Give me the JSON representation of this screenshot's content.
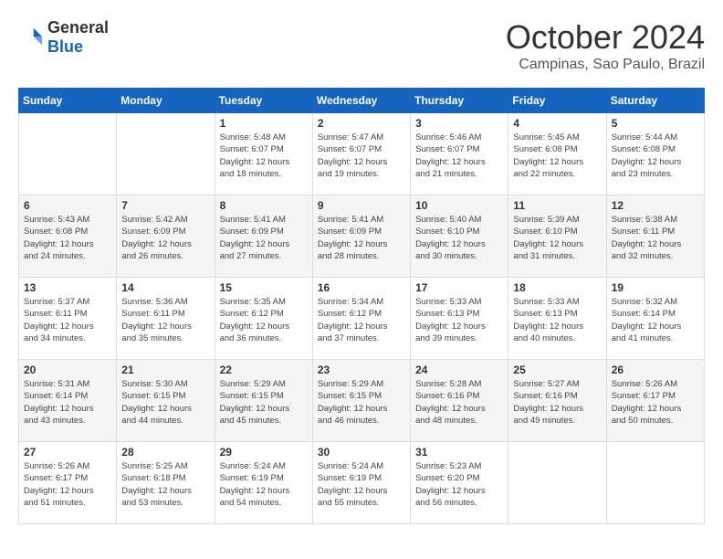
{
  "logo": {
    "general": "General",
    "blue": "Blue"
  },
  "title": {
    "month": "October 2024",
    "location": "Campinas, Sao Paulo, Brazil"
  },
  "headers": [
    "Sunday",
    "Monday",
    "Tuesday",
    "Wednesday",
    "Thursday",
    "Friday",
    "Saturday"
  ],
  "weeks": [
    [
      {
        "day": "",
        "info": ""
      },
      {
        "day": "",
        "info": ""
      },
      {
        "day": "1",
        "info": "Sunrise: 5:48 AM\nSunset: 6:07 PM\nDaylight: 12 hours\nand 18 minutes."
      },
      {
        "day": "2",
        "info": "Sunrise: 5:47 AM\nSunset: 6:07 PM\nDaylight: 12 hours\nand 19 minutes."
      },
      {
        "day": "3",
        "info": "Sunrise: 5:46 AM\nSunset: 6:07 PM\nDaylight: 12 hours\nand 21 minutes."
      },
      {
        "day": "4",
        "info": "Sunrise: 5:45 AM\nSunset: 6:08 PM\nDaylight: 12 hours\nand 22 minutes."
      },
      {
        "day": "5",
        "info": "Sunrise: 5:44 AM\nSunset: 6:08 PM\nDaylight: 12 hours\nand 23 minutes."
      }
    ],
    [
      {
        "day": "6",
        "info": "Sunrise: 5:43 AM\nSunset: 6:08 PM\nDaylight: 12 hours\nand 24 minutes."
      },
      {
        "day": "7",
        "info": "Sunrise: 5:42 AM\nSunset: 6:09 PM\nDaylight: 12 hours\nand 26 minutes."
      },
      {
        "day": "8",
        "info": "Sunrise: 5:41 AM\nSunset: 6:09 PM\nDaylight: 12 hours\nand 27 minutes."
      },
      {
        "day": "9",
        "info": "Sunrise: 5:41 AM\nSunset: 6:09 PM\nDaylight: 12 hours\nand 28 minutes."
      },
      {
        "day": "10",
        "info": "Sunrise: 5:40 AM\nSunset: 6:10 PM\nDaylight: 12 hours\nand 30 minutes."
      },
      {
        "day": "11",
        "info": "Sunrise: 5:39 AM\nSunset: 6:10 PM\nDaylight: 12 hours\nand 31 minutes."
      },
      {
        "day": "12",
        "info": "Sunrise: 5:38 AM\nSunset: 6:11 PM\nDaylight: 12 hours\nand 32 minutes."
      }
    ],
    [
      {
        "day": "13",
        "info": "Sunrise: 5:37 AM\nSunset: 6:11 PM\nDaylight: 12 hours\nand 34 minutes."
      },
      {
        "day": "14",
        "info": "Sunrise: 5:36 AM\nSunset: 6:11 PM\nDaylight: 12 hours\nand 35 minutes."
      },
      {
        "day": "15",
        "info": "Sunrise: 5:35 AM\nSunset: 6:12 PM\nDaylight: 12 hours\nand 36 minutes."
      },
      {
        "day": "16",
        "info": "Sunrise: 5:34 AM\nSunset: 6:12 PM\nDaylight: 12 hours\nand 37 minutes."
      },
      {
        "day": "17",
        "info": "Sunrise: 5:33 AM\nSunset: 6:13 PM\nDaylight: 12 hours\nand 39 minutes."
      },
      {
        "day": "18",
        "info": "Sunrise: 5:33 AM\nSunset: 6:13 PM\nDaylight: 12 hours\nand 40 minutes."
      },
      {
        "day": "19",
        "info": "Sunrise: 5:32 AM\nSunset: 6:14 PM\nDaylight: 12 hours\nand 41 minutes."
      }
    ],
    [
      {
        "day": "20",
        "info": "Sunrise: 5:31 AM\nSunset: 6:14 PM\nDaylight: 12 hours\nand 43 minutes."
      },
      {
        "day": "21",
        "info": "Sunrise: 5:30 AM\nSunset: 6:15 PM\nDaylight: 12 hours\nand 44 minutes."
      },
      {
        "day": "22",
        "info": "Sunrise: 5:29 AM\nSunset: 6:15 PM\nDaylight: 12 hours\nand 45 minutes."
      },
      {
        "day": "23",
        "info": "Sunrise: 5:29 AM\nSunset: 6:15 PM\nDaylight: 12 hours\nand 46 minutes."
      },
      {
        "day": "24",
        "info": "Sunrise: 5:28 AM\nSunset: 6:16 PM\nDaylight: 12 hours\nand 48 minutes."
      },
      {
        "day": "25",
        "info": "Sunrise: 5:27 AM\nSunset: 6:16 PM\nDaylight: 12 hours\nand 49 minutes."
      },
      {
        "day": "26",
        "info": "Sunrise: 5:26 AM\nSunset: 6:17 PM\nDaylight: 12 hours\nand 50 minutes."
      }
    ],
    [
      {
        "day": "27",
        "info": "Sunrise: 5:26 AM\nSunset: 6:17 PM\nDaylight: 12 hours\nand 51 minutes."
      },
      {
        "day": "28",
        "info": "Sunrise: 5:25 AM\nSunset: 6:18 PM\nDaylight: 12 hours\nand 53 minutes."
      },
      {
        "day": "29",
        "info": "Sunrise: 5:24 AM\nSunset: 6:19 PM\nDaylight: 12 hours\nand 54 minutes."
      },
      {
        "day": "30",
        "info": "Sunrise: 5:24 AM\nSunset: 6:19 PM\nDaylight: 12 hours\nand 55 minutes."
      },
      {
        "day": "31",
        "info": "Sunrise: 5:23 AM\nSunset: 6:20 PM\nDaylight: 12 hours\nand 56 minutes."
      },
      {
        "day": "",
        "info": ""
      },
      {
        "day": "",
        "info": ""
      }
    ]
  ]
}
